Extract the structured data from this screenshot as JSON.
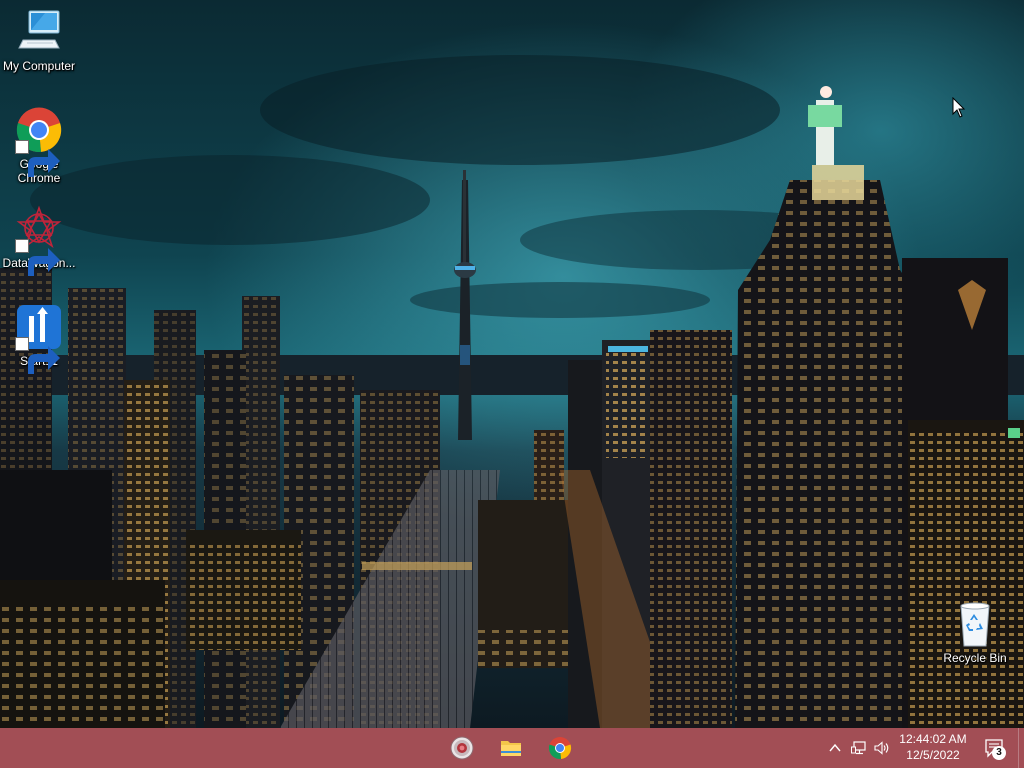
{
  "desktop": {
    "icons": [
      {
        "label": "My Computer",
        "icon": "computer-icon"
      },
      {
        "label": "Google\nChrome",
        "icon": "chrome-icon"
      },
      {
        "label": "DataWagon...",
        "icon": "datawagon-icon"
      },
      {
        "label": "Start11",
        "icon": "start11-icon"
      },
      {
        "label": "Recycle Bin",
        "icon": "recycle-bin-icon"
      }
    ]
  },
  "taskbar": {
    "color": "#a24e55",
    "pinned_apps": [
      {
        "name": "Start menu",
        "icon": "start-orb-icon"
      },
      {
        "name": "File Explorer",
        "icon": "folder-icon"
      },
      {
        "name": "Google Chrome",
        "icon": "chrome-icon"
      }
    ],
    "tray": {
      "icons": [
        "chevron-up-icon",
        "network-icon",
        "volume-icon"
      ],
      "time": "12:44:02 AM",
      "date": "12/5/2022",
      "notification_count": "3"
    }
  }
}
